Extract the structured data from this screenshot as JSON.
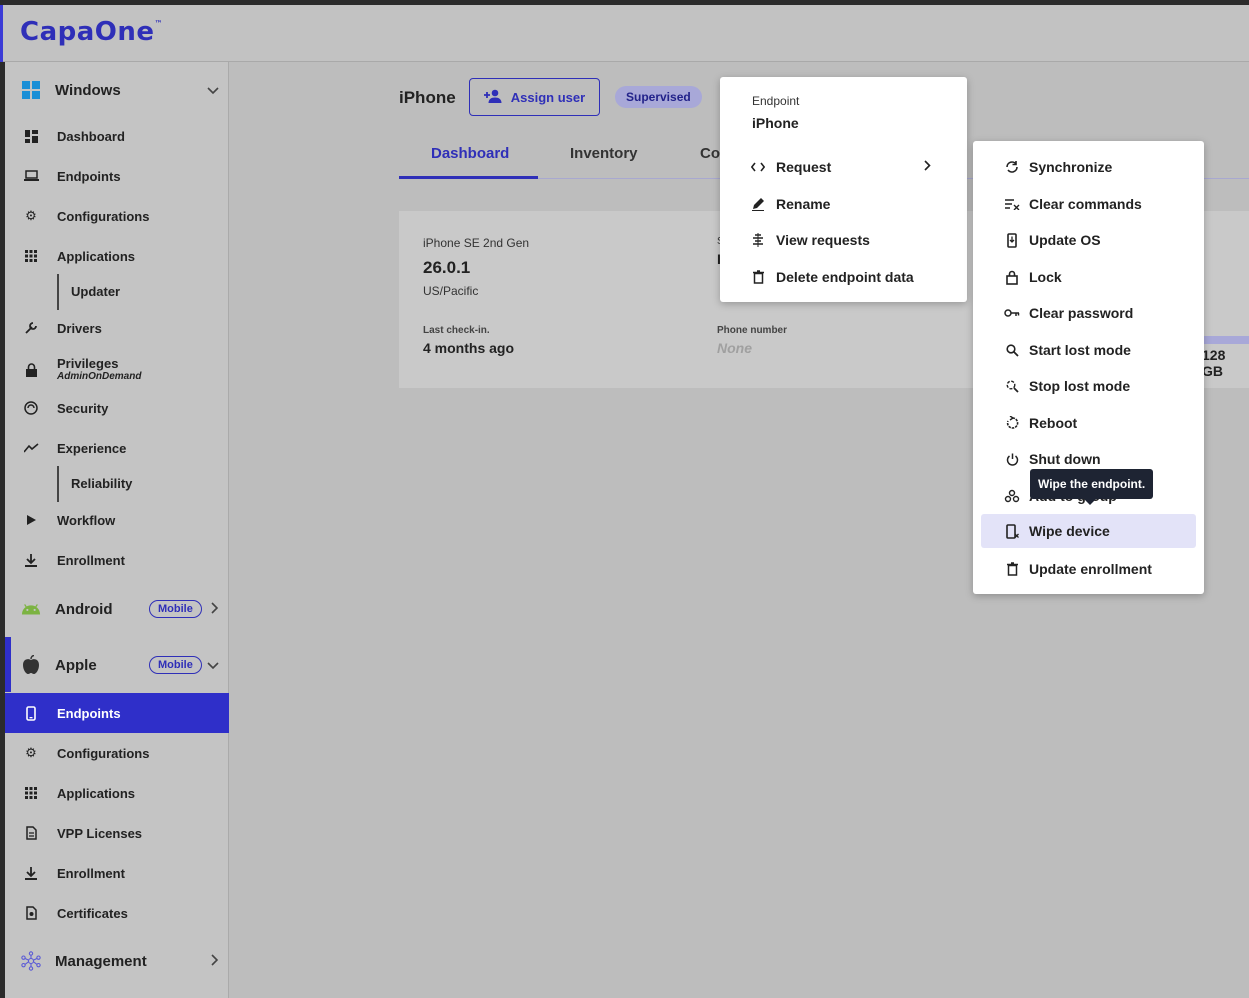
{
  "app": {
    "logo": "CapaOne",
    "logo_tm": "™"
  },
  "sidebar": {
    "windows": {
      "label": "Windows",
      "items": [
        {
          "label": "Dashboard",
          "icon": "dashboard-icon"
        },
        {
          "label": "Endpoints",
          "icon": "laptop-icon"
        },
        {
          "label": "Configurations",
          "icon": "gear-icon"
        },
        {
          "label": "Applications",
          "icon": "grid-icon"
        },
        {
          "label": "Updater",
          "icon": ""
        },
        {
          "label": "Drivers",
          "icon": "wrench-icon"
        },
        {
          "label": "Privileges",
          "sublabel": "AdminOnDemand",
          "icon": "lock-icon"
        },
        {
          "label": "Security",
          "icon": "shield-icon"
        },
        {
          "label": "Experience",
          "icon": "trend-icon"
        },
        {
          "label": "Reliability",
          "icon": ""
        },
        {
          "label": "Workflow",
          "icon": "play-icon"
        },
        {
          "label": "Enrollment",
          "icon": "download-icon"
        }
      ]
    },
    "android": {
      "label": "Android",
      "badge": "Mobile"
    },
    "apple": {
      "label": "Apple",
      "badge": "Mobile",
      "items": [
        {
          "label": "Endpoints",
          "icon": "phone-icon"
        },
        {
          "label": "Configurations",
          "icon": "gear-icon"
        },
        {
          "label": "Applications",
          "icon": "grid-icon"
        },
        {
          "label": "VPP Licenses",
          "icon": "document-icon"
        },
        {
          "label": "Enrollment",
          "icon": "download-icon"
        },
        {
          "label": "Certificates",
          "icon": "certificate-icon"
        }
      ]
    },
    "management": {
      "label": "Management"
    }
  },
  "page": {
    "title": "iPhone",
    "assign_user": "Assign user",
    "supervised": "Supervised",
    "tabs": [
      "Dashboard",
      "Inventory",
      "Co"
    ]
  },
  "card": {
    "model": "iPhone SE 2nd Gen",
    "os_version": "26.0.1",
    "timezone": "US/Pacific",
    "last_checkin_label": "Last check-in.",
    "last_checkin_value": "4 months ago",
    "phone_label": "Phone number",
    "phone_value": "None",
    "storage": "128 GB",
    "hidden_col_s": "S",
    "hidden_col_i": "I"
  },
  "context_menu": {
    "header_label": "Endpoint",
    "header_value": "iPhone",
    "items": [
      {
        "label": "Request",
        "icon": "code-icon",
        "submenu": true
      },
      {
        "label": "Rename",
        "icon": "pencil-icon"
      },
      {
        "label": "View requests",
        "icon": "list-icon"
      },
      {
        "label": "Delete endpoint data",
        "icon": "trash-icon"
      }
    ]
  },
  "request_submenu": {
    "items": [
      {
        "label": "Synchronize",
        "icon": "sync-icon"
      },
      {
        "label": "Clear commands",
        "icon": "clear-list-icon"
      },
      {
        "label": "Update OS",
        "icon": "phone-download-icon"
      },
      {
        "label": "Lock",
        "icon": "lock-icon"
      },
      {
        "label": "Clear password",
        "icon": "key-icon"
      },
      {
        "label": "Start lost mode",
        "icon": "search-icon"
      },
      {
        "label": "Stop lost mode",
        "icon": "search-off-icon"
      },
      {
        "label": "Reboot",
        "icon": "reboot-icon"
      },
      {
        "label": "Shut down",
        "icon": "power-icon"
      },
      {
        "label": "Add to group",
        "icon": "group-icon"
      },
      {
        "label": "Wipe device",
        "icon": "phone-wipe-icon"
      },
      {
        "label": "Update enrollment",
        "icon": "trash-icon"
      }
    ]
  },
  "tooltip": {
    "text": "Wipe the endpoint."
  },
  "colors": {
    "accent": "#2f2fb8",
    "active_bg": "#2f2fc9",
    "highlight": "#e3e3f8"
  }
}
